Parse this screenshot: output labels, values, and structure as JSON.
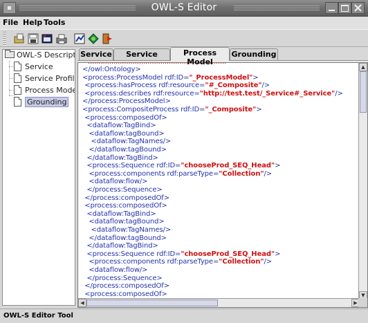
{
  "window": {
    "title": "OWL-S Editor"
  },
  "menu": {
    "items": [
      "File",
      "Help",
      "Tools"
    ]
  },
  "toolbar": {
    "buttons": [
      "open-icon",
      "save-icon",
      "window-icon",
      "print-icon",
      "chart-icon",
      "globe-icon",
      "exit-icon"
    ]
  },
  "tree": {
    "root": "OWL-S Descriptio",
    "items": [
      "Service",
      "Service Profile",
      "Process Mode",
      "Grounding"
    ],
    "selected": "Grounding"
  },
  "tabs": {
    "items": [
      "Service",
      "Service Profile",
      "Process Model",
      "Grounding"
    ],
    "active": "Process Model"
  },
  "code": {
    "lines": [
      {
        "pre": "  </owl:Ontology>",
        "str": "",
        "post": ""
      },
      {
        "pre": "  <process:ProcessModel rdf:ID=",
        "str": "\"_ProcessModel\"",
        "post": ">"
      },
      {
        "pre": "   <process:hasProcess rdf:resource=",
        "str": "\"#_Composite\"",
        "post": "/>"
      },
      {
        "pre": "   <process:describes rdf:resource=",
        "str": "\"http://test.test/_Service#_Service\"",
        "post": "/>"
      },
      {
        "pre": "  </process:ProcessModel>",
        "str": "",
        "post": ""
      },
      {
        "pre": "  <process:CompositeProcess rdf:ID=",
        "str": "\"_Composite\"",
        "post": ">"
      },
      {
        "pre": "   <process:composedOf>",
        "str": "",
        "post": ""
      },
      {
        "pre": "    <dataflow:TagBind>",
        "str": "",
        "post": ""
      },
      {
        "pre": "     <dataflow:tagBound>",
        "str": "",
        "post": ""
      },
      {
        "pre": "      <dataflow:TagNames/>",
        "str": "",
        "post": ""
      },
      {
        "pre": "     </dataflow:tagBound>",
        "str": "",
        "post": ""
      },
      {
        "pre": "    </dataflow:TagBind>",
        "str": "",
        "post": ""
      },
      {
        "pre": "    <process:Sequence rdf:ID=",
        "str": "\"chooseProd_SEQ_Head\"",
        "post": ">"
      },
      {
        "pre": "     <process:components rdf:parseType=",
        "str": "\"Collection\"",
        "post": "/>"
      },
      {
        "pre": "     <dataflow:flow/>",
        "str": "",
        "post": ""
      },
      {
        "pre": "    </process:Sequence>",
        "str": "",
        "post": ""
      },
      {
        "pre": "   </process:composedOf>",
        "str": "",
        "post": ""
      },
      {
        "pre": "   <process:composedOf>",
        "str": "",
        "post": ""
      },
      {
        "pre": "    <dataflow:TagBind>",
        "str": "",
        "post": ""
      },
      {
        "pre": "     <dataflow:tagBound>",
        "str": "",
        "post": ""
      },
      {
        "pre": "      <dataflow:TagNames/>",
        "str": "",
        "post": ""
      },
      {
        "pre": "     </dataflow:tagBound>",
        "str": "",
        "post": ""
      },
      {
        "pre": "    </dataflow:TagBind>",
        "str": "",
        "post": ""
      },
      {
        "pre": "    <process:Sequence rdf:ID=",
        "str": "\"chooseProd_SEQ_Head\"",
        "post": ">"
      },
      {
        "pre": "     <process:components rdf:parseType=",
        "str": "\"Collection\"",
        "post": "/>"
      },
      {
        "pre": "     <dataflow:flow/>",
        "str": "",
        "post": ""
      },
      {
        "pre": "    </process:Sequence>",
        "str": "",
        "post": ""
      },
      {
        "pre": "   </process:composedOf>",
        "str": "",
        "post": ""
      },
      {
        "pre": "   <process:composedOf>",
        "str": "",
        "post": ""
      }
    ]
  },
  "status": {
    "text": "OWL-S Editor Tool"
  },
  "colors": {
    "tag": "#2233aa",
    "string": "#cc1111",
    "selection": "#c7cbe6"
  }
}
